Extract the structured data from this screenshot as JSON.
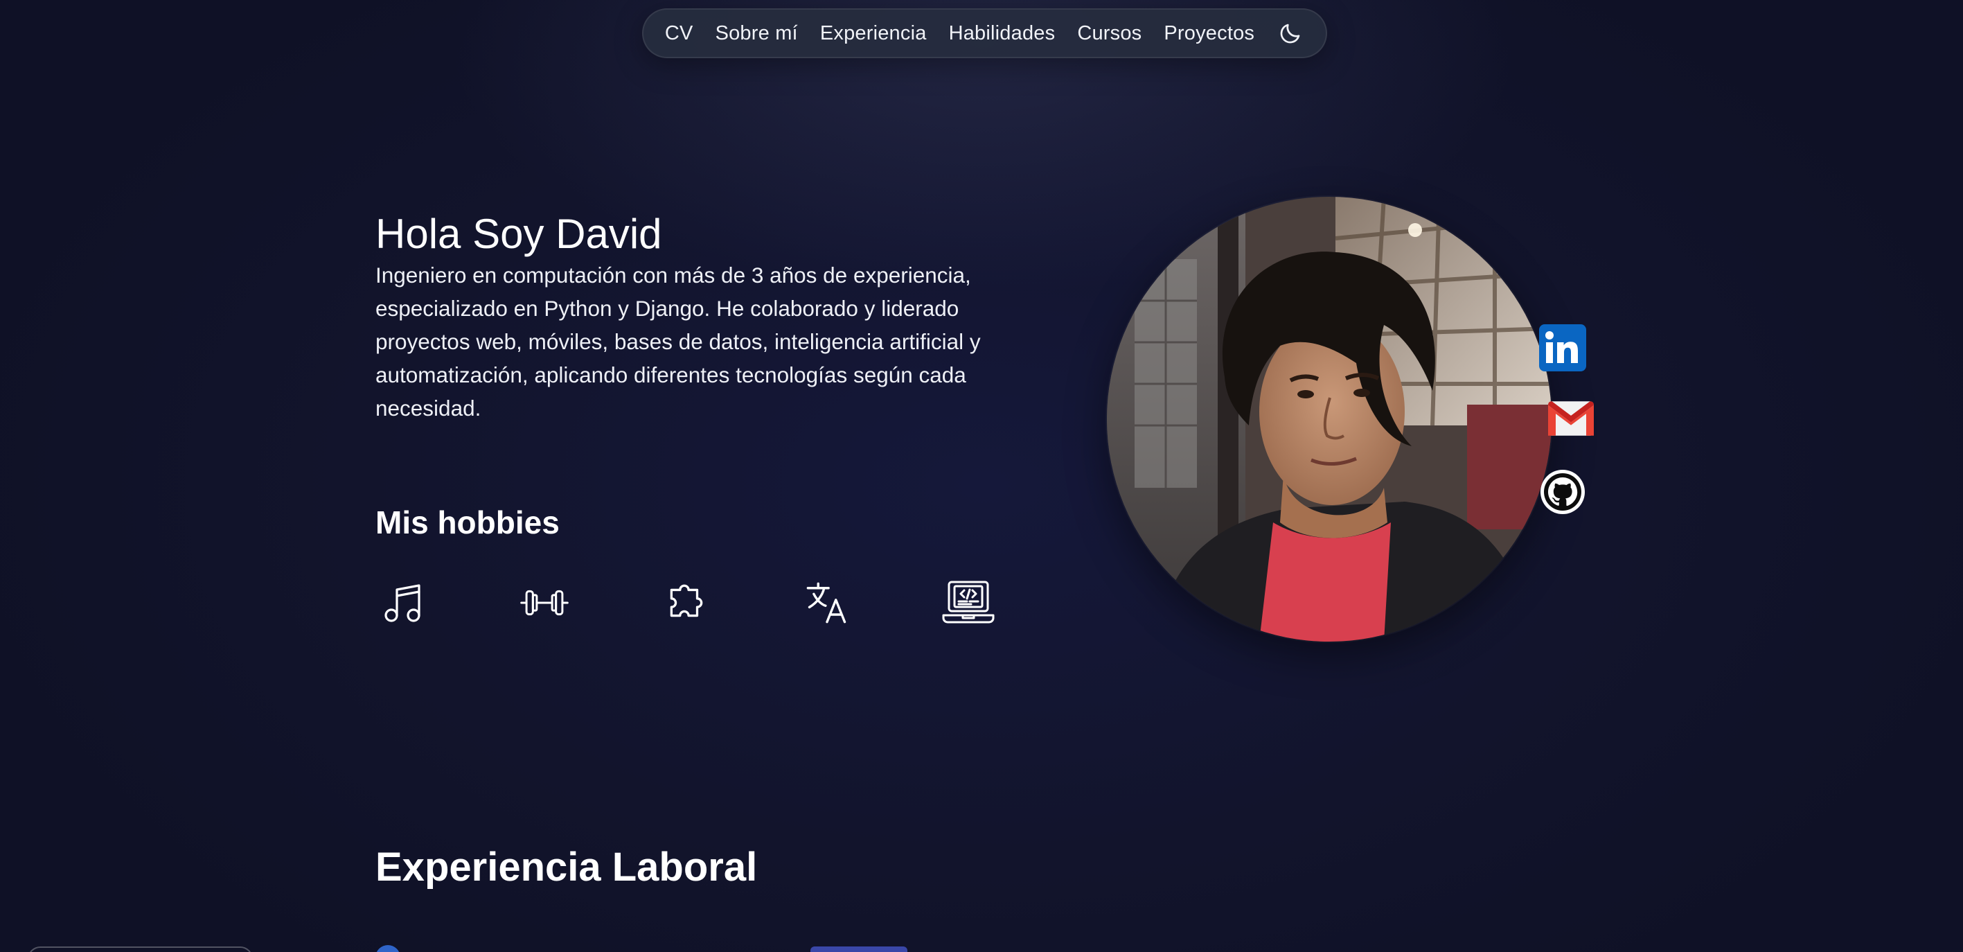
{
  "colors": {
    "background": "#12142b",
    "nav_background": "#262c3e",
    "text": "#ffffff",
    "linkedin": "#0a66c2",
    "gmail_red": "#ea4335",
    "timeline_accent": "#2f64c8"
  },
  "nav": {
    "items": [
      {
        "label": "CV"
      },
      {
        "label": "Sobre mí"
      },
      {
        "label": "Experiencia"
      },
      {
        "label": "Habilidades"
      },
      {
        "label": "Cursos"
      },
      {
        "label": "Proyectos"
      }
    ],
    "theme_toggle_icon": "moon-icon"
  },
  "hero": {
    "title": "Hola Soy David",
    "description": "Ingeniero en computación con más de 3 años de experiencia, especializado en Python y Django. He colaborado y liderado proyectos web, móviles, bases de datos, inteligencia artificial y automatización, aplicando diferentes tecnologías según cada necesidad."
  },
  "hobbies": {
    "title": "Mis hobbies",
    "icons": [
      "music-note-icon",
      "dumbbell-icon",
      "puzzle-piece-icon",
      "translate-icon",
      "laptop-code-icon"
    ]
  },
  "profile": {
    "photo": "profile-photo",
    "social_icons": [
      "linkedin-icon",
      "gmail-icon",
      "github-icon"
    ]
  },
  "experience": {
    "title": "Experiencia Laboral"
  }
}
